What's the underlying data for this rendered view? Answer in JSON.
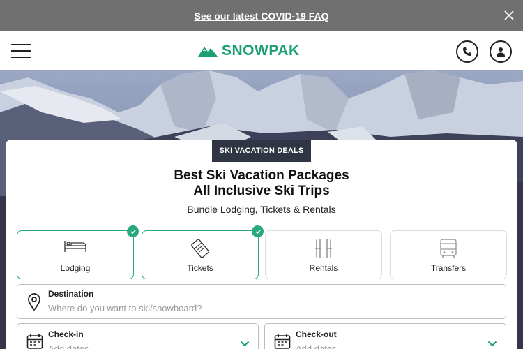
{
  "banner": {
    "link_text": "See our latest COVID-19 FAQ"
  },
  "header": {
    "brand": "SNOWPAK"
  },
  "card": {
    "badge": "SKI VACATION DEALS",
    "title_line1": "Best Ski Vacation Packages",
    "title_line2": "All Inclusive Ski Trips",
    "subtitle": "Bundle Lodging, Tickets & Rentals"
  },
  "options": [
    {
      "label": "Lodging",
      "selected": true,
      "icon": "bed-icon"
    },
    {
      "label": "Tickets",
      "selected": true,
      "icon": "ticket-icon"
    },
    {
      "label": "Rentals",
      "selected": false,
      "icon": "skis-icon"
    },
    {
      "label": "Transfers",
      "selected": false,
      "icon": "bus-icon"
    }
  ],
  "destination": {
    "label": "Destination",
    "placeholder": "Where do you want to ski/snowboard?"
  },
  "checkin": {
    "label": "Check-in",
    "placeholder": "Add dates"
  },
  "checkout": {
    "label": "Check-out",
    "placeholder": "Add dates"
  },
  "colors": {
    "brand": "#1a9e73",
    "accent": "#2aa881",
    "badge": "#2f3542",
    "banner": "#707070"
  }
}
